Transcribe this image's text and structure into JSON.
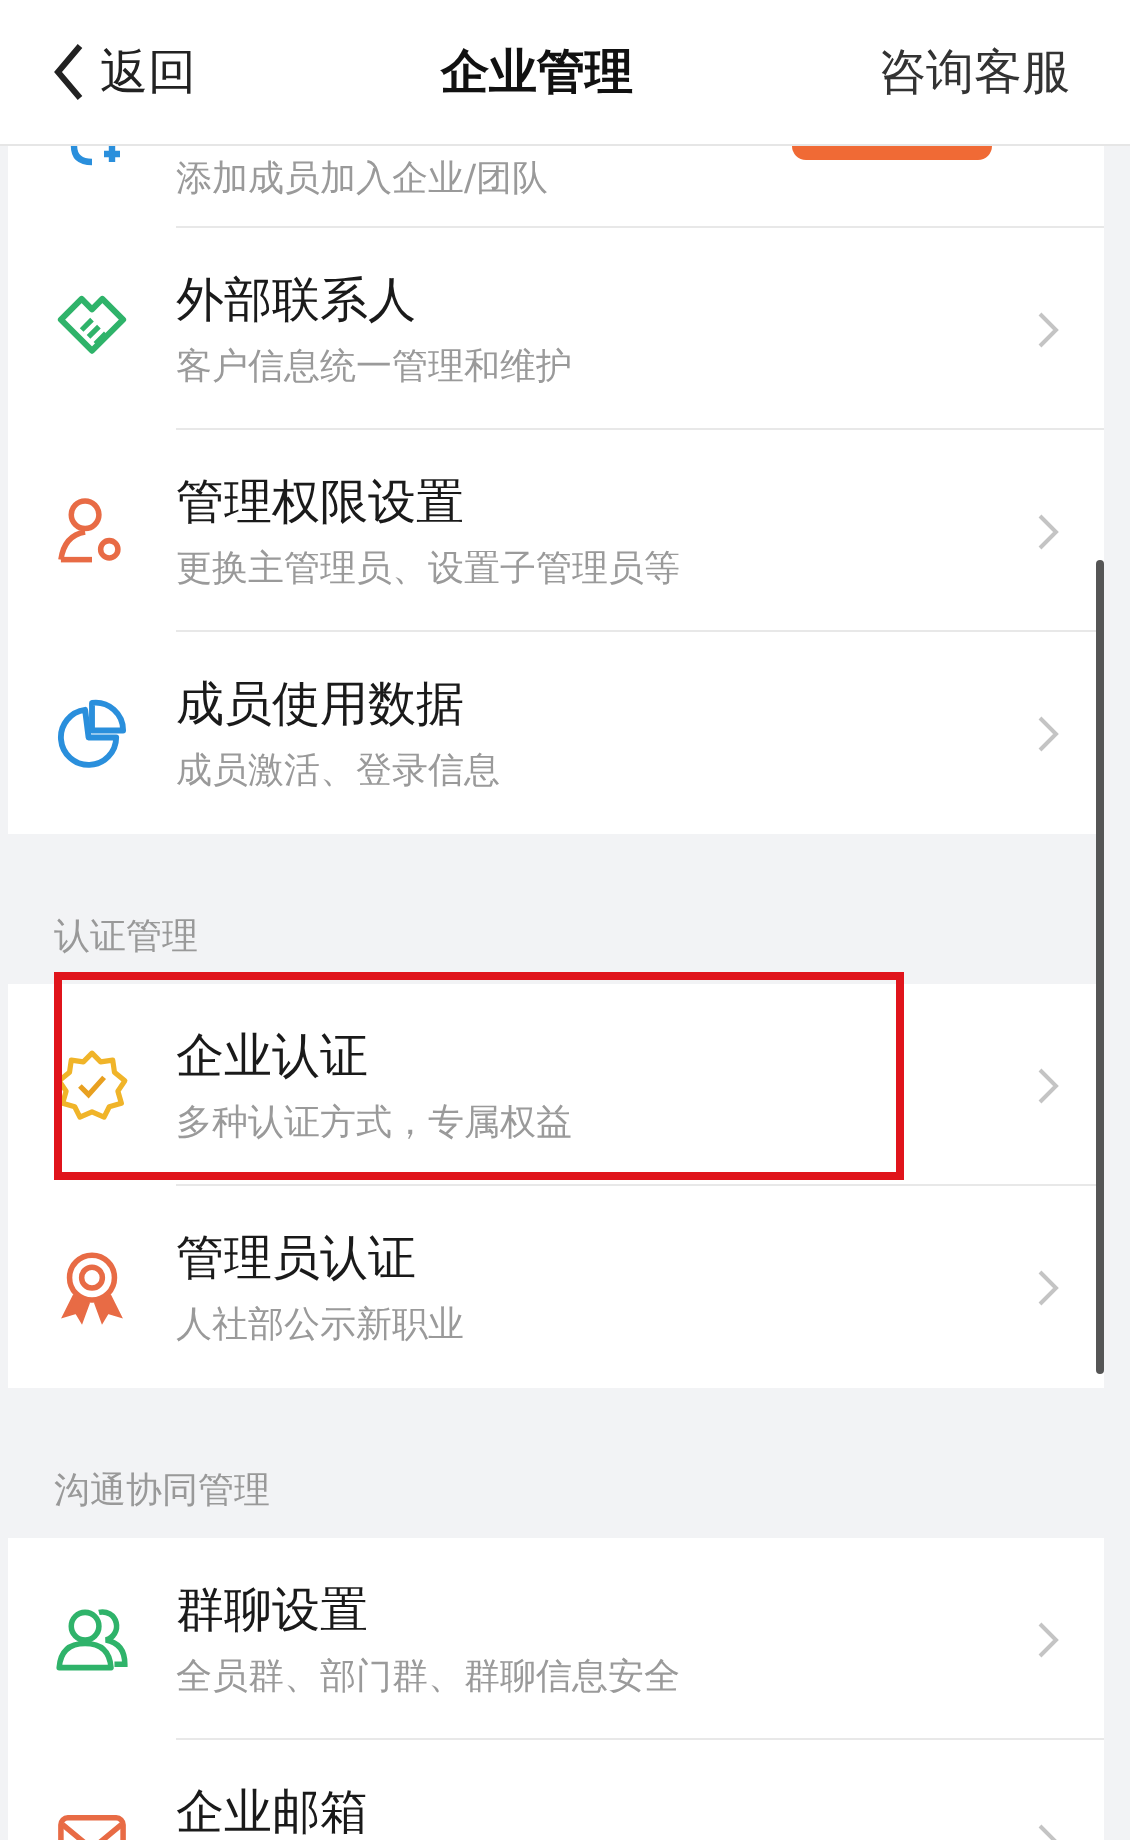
{
  "nav": {
    "back_label": "返回",
    "title": "企业管理",
    "action": "咨询客服"
  },
  "partial_item": {
    "subtitle": "添加成员加入企业/团队",
    "action_button": true
  },
  "groups": [
    {
      "items": [
        {
          "kind": "handshake",
          "title": "外部联系人",
          "subtitle": "客户信息统一管理和维护",
          "highlighted": false
        },
        {
          "kind": "person-gear",
          "title": "管理权限设置",
          "subtitle": "更换主管理员、设置子管理员等",
          "highlighted": false
        },
        {
          "kind": "pie",
          "title": "成员使用数据",
          "subtitle": "成员激活、登录信息",
          "highlighted": false
        }
      ]
    },
    {
      "header": "认证管理",
      "items": [
        {
          "kind": "badge-check",
          "title": "企业认证",
          "subtitle": "多种认证方式，专属权益",
          "highlighted": true
        },
        {
          "kind": "medal",
          "title": "管理员认证",
          "subtitle": "人社部公示新职业",
          "highlighted": false
        }
      ]
    },
    {
      "header": "沟通协同管理",
      "items": [
        {
          "kind": "people",
          "title": "群聊设置",
          "subtitle": "全员群、部门群、群聊信息安全",
          "highlighted": false
        },
        {
          "kind": "mail",
          "title": "企业邮箱",
          "highlighted": false
        }
      ]
    }
  ]
}
